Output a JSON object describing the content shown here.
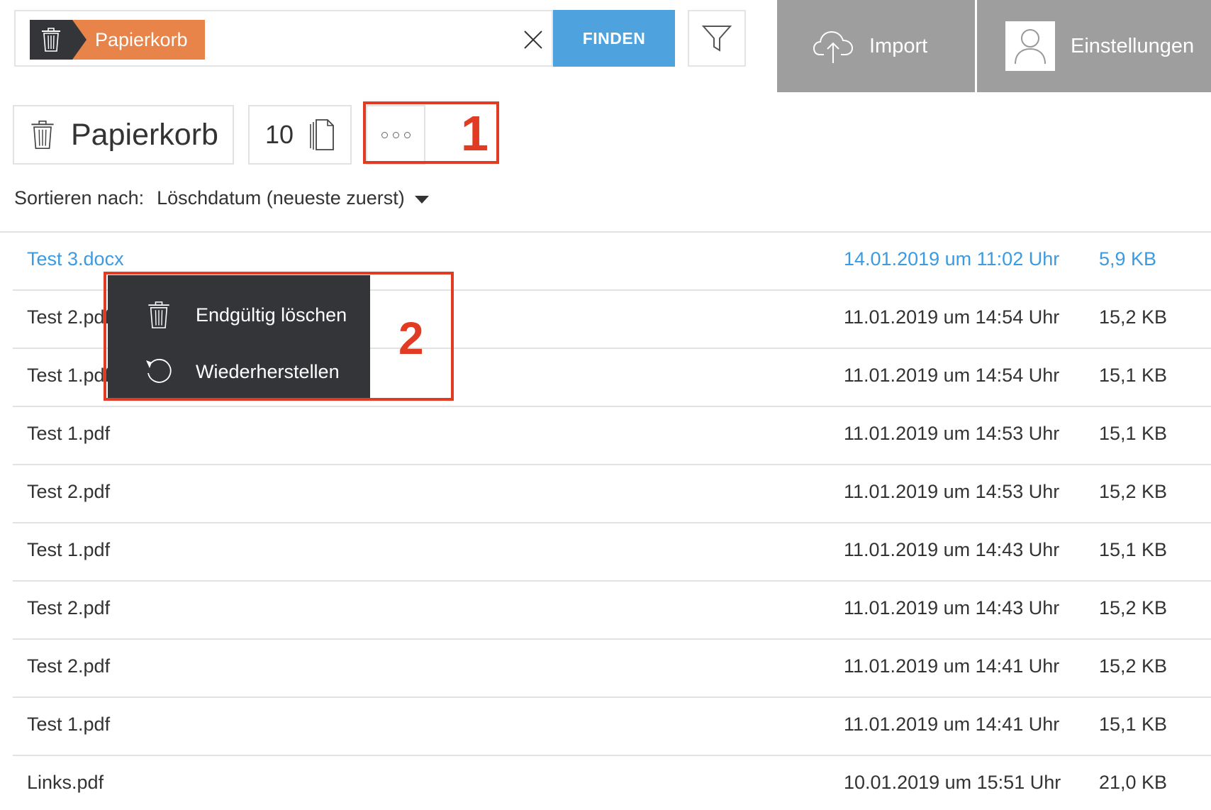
{
  "search": {
    "chip_label": "Papierkorb",
    "find_label": "FINDEN"
  },
  "top_buttons": {
    "import_label": "Import",
    "settings_label": "Einstellungen"
  },
  "toolbar": {
    "title": "Papierkorb",
    "count": "10"
  },
  "annotations": {
    "one": "1",
    "two": "2"
  },
  "sort": {
    "label": "Sortieren nach:",
    "value": "Löschdatum (neueste zuerst)"
  },
  "files": [
    {
      "name": "Test 3.docx",
      "date": "14.01.2019 um 11:02 Uhr",
      "size": "5,9 KB"
    },
    {
      "name": "Test 2.pdf",
      "date": "11.01.2019 um 14:54 Uhr",
      "size": "15,2 KB"
    },
    {
      "name": "Test 1.pdf",
      "date": "11.01.2019 um 14:54 Uhr",
      "size": "15,1 KB"
    },
    {
      "name": "Test 1.pdf",
      "date": "11.01.2019 um 14:53 Uhr",
      "size": "15,1 KB"
    },
    {
      "name": "Test 2.pdf",
      "date": "11.01.2019 um 14:53 Uhr",
      "size": "15,2 KB"
    },
    {
      "name": "Test 1.pdf",
      "date": "11.01.2019 um 14:43 Uhr",
      "size": "15,1 KB"
    },
    {
      "name": "Test 2.pdf",
      "date": "11.01.2019 um 14:43 Uhr",
      "size": "15,2 KB"
    },
    {
      "name": "Test 2.pdf",
      "date": "11.01.2019 um 14:41 Uhr",
      "size": "15,2 KB"
    },
    {
      "name": "Test 1.pdf",
      "date": "11.01.2019 um 14:41 Uhr",
      "size": "15,1 KB"
    },
    {
      "name": "Links.pdf",
      "date": "10.01.2019 um 15:51 Uhr",
      "size": "21,0 KB"
    }
  ],
  "context_menu": {
    "delete_label": "Endgültig löschen",
    "restore_label": "Wiederherstellen"
  },
  "colors": {
    "accent": "#4ea3df",
    "chip": "#e8834a",
    "annotation": "#e23b23",
    "dark": "#333538"
  }
}
